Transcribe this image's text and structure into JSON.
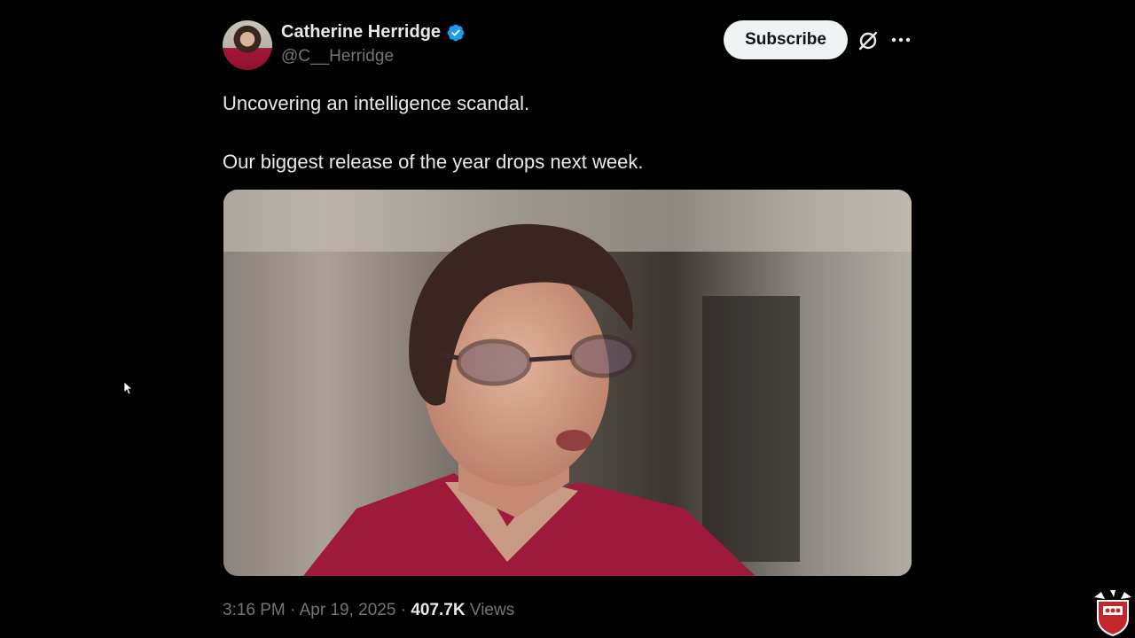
{
  "author": {
    "display_name": "Catherine Herridge",
    "handle": "@C__Herridge",
    "verified": true,
    "avatar_icon": "profile-photo"
  },
  "actions": {
    "subscribe_label": "Subscribe",
    "grok_icon": "grok-icon",
    "more_icon": "more-options-icon"
  },
  "tweet": {
    "line1": "Uncovering an intelligence scandal.",
    "line2": "Our biggest release of the year drops next week."
  },
  "media": {
    "type": "video",
    "description_icon": "video-thumbnail"
  },
  "meta": {
    "time": "3:16 PM",
    "date": "Apr 19, 2025",
    "views_count": "407.7K",
    "views_label": "Views"
  },
  "colors": {
    "background": "#000000",
    "text": "#e7e9ea",
    "muted": "#71767b",
    "verified": "#1d9bf0",
    "subscribe_bg": "#eff3f4"
  }
}
